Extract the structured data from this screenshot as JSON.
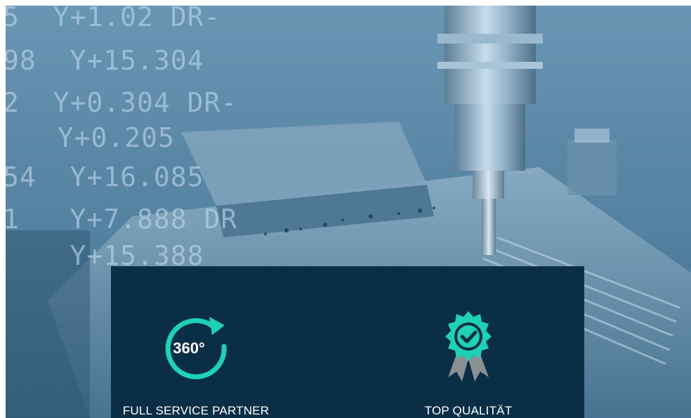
{
  "hero": {
    "background_overlay_text": [
      "5  Y+1.02 DR-",
      "98  Y+15.304",
      "2  Y+0.304 DR-",
      "  Y+0.205",
      "54  Y+16.085",
      "1   Y+7.888 DR",
      "    Y+15.388"
    ]
  },
  "features": [
    {
      "label": "FULL SERVICE PARTNER",
      "icon": "360-rotation-icon",
      "icon_text": "360°"
    },
    {
      "label": "TOP QUALITÄT",
      "icon": "quality-award-badge-icon"
    }
  ],
  "colors": {
    "panel_bg": "#0b2e47",
    "accent_teal": "#1fd1b5",
    "badge_ribbon": "#8a8f93",
    "label_text": "#ffffff"
  }
}
